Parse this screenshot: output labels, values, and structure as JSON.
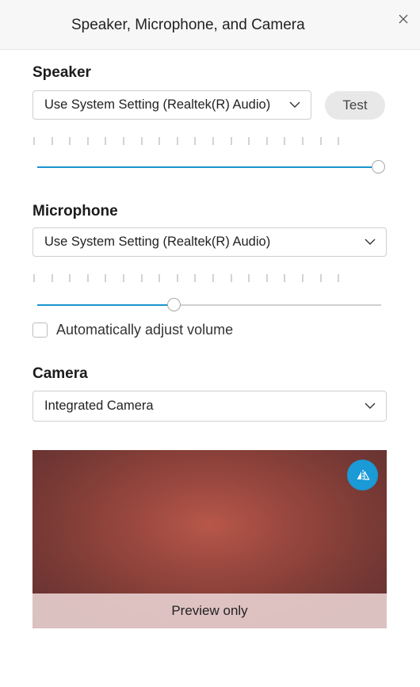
{
  "window": {
    "title": "Speaker, Microphone, and Camera"
  },
  "speaker": {
    "label": "Speaker",
    "device": "Use System Setting (Realtek(R) Audio)",
    "test_label": "Test",
    "volume_fraction": 1.0
  },
  "microphone": {
    "label": "Microphone",
    "device": "Use System Setting (Realtek(R) Audio)",
    "volume_fraction": 0.4,
    "auto_adjust_label": "Automatically adjust volume",
    "auto_adjust_checked": false
  },
  "camera": {
    "label": "Camera",
    "device": "Integrated Camera",
    "preview_caption": "Preview only"
  },
  "colors": {
    "accent": "#1a94cf",
    "mirror_button": "#1a9ad6"
  },
  "icons": {
    "close": "close-icon",
    "chevron": "chevron-down-icon",
    "mirror": "mirror-flip-icon"
  }
}
